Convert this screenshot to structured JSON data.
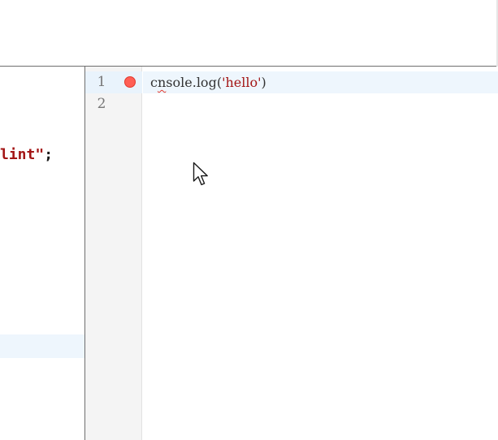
{
  "left_pane": {
    "lines": [
      {
        "string": "lint\"",
        "punct": ";"
      }
    ]
  },
  "editor": {
    "line_numbers": [
      "1",
      "2"
    ],
    "code": {
      "t1": "c",
      "t2": "n",
      "t3": "sole",
      "t4": ".",
      "t5": "log",
      "t6": "(",
      "t7": "'hello'",
      "t8": ")"
    }
  },
  "colors": {
    "breakpoint": "#ff5f55",
    "string": "#a31515",
    "active_line": "#eef6fd"
  },
  "icons": {
    "cursor": "mouse-pointer-icon",
    "breakpoint": "breakpoint-dot-icon"
  }
}
